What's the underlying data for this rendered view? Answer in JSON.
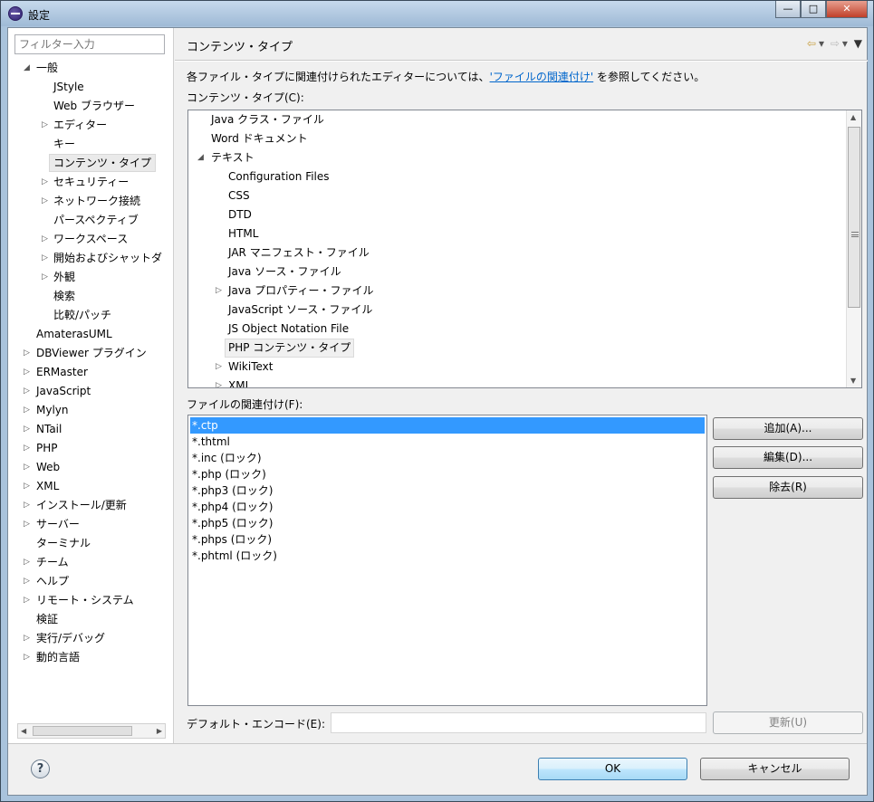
{
  "window": {
    "title": "設定",
    "min": "—",
    "max": "□",
    "close": "✕"
  },
  "nav": {
    "filter_placeholder": "フィルター入力",
    "items": [
      {
        "label": "一般",
        "arrow": "◢"
      },
      {
        "label": "JStyle",
        "arrow": ""
      },
      {
        "label": "Web ブラウザー",
        "arrow": ""
      },
      {
        "label": "エディター",
        "arrow": "▷"
      },
      {
        "label": "キー",
        "arrow": ""
      },
      {
        "label": "コンテンツ・タイプ",
        "arrow": ""
      },
      {
        "label": "セキュリティー",
        "arrow": "▷"
      },
      {
        "label": "ネットワーク接続",
        "arrow": "▷"
      },
      {
        "label": "パースペクティブ",
        "arrow": ""
      },
      {
        "label": "ワークスペース",
        "arrow": "▷"
      },
      {
        "label": "開始およびシャットダ",
        "arrow": "▷"
      },
      {
        "label": "外観",
        "arrow": "▷"
      },
      {
        "label": "検索",
        "arrow": ""
      },
      {
        "label": "比較/パッチ",
        "arrow": ""
      },
      {
        "label": "AmaterasUML",
        "arrow": ""
      },
      {
        "label": "DBViewer プラグイン",
        "arrow": "▷"
      },
      {
        "label": "ERMaster",
        "arrow": "▷"
      },
      {
        "label": "JavaScript",
        "arrow": "▷"
      },
      {
        "label": "Mylyn",
        "arrow": "▷"
      },
      {
        "label": "NTail",
        "arrow": "▷"
      },
      {
        "label": "PHP",
        "arrow": "▷"
      },
      {
        "label": "Web",
        "arrow": "▷"
      },
      {
        "label": "XML",
        "arrow": "▷"
      },
      {
        "label": "インストール/更新",
        "arrow": "▷"
      },
      {
        "label": "サーバー",
        "arrow": "▷"
      },
      {
        "label": "ターミナル",
        "arrow": ""
      },
      {
        "label": "チーム",
        "arrow": "▷"
      },
      {
        "label": "ヘルプ",
        "arrow": "▷"
      },
      {
        "label": "リモート・システム",
        "arrow": "▷"
      },
      {
        "label": "検証",
        "arrow": ""
      },
      {
        "label": "実行/デバッグ",
        "arrow": "▷"
      },
      {
        "label": "動的言語",
        "arrow": "▷"
      }
    ]
  },
  "page": {
    "title": "コンテンツ・タイプ",
    "desc_prefix": "各ファイル・タイプに関連付けられたエディターについては、",
    "desc_link": "'ファイルの関連付け'",
    "desc_suffix": " を参照してください。",
    "content_types_label": "コンテンツ・タイプ(C):",
    "file_assoc_label": "ファイルの関連付け(F):",
    "encoding_label": "デフォルト・エンコード(E):",
    "encoding_value": ""
  },
  "tree": [
    {
      "label": "Java クラス・ファイル",
      "arrow": ""
    },
    {
      "label": "Word ドキュメント",
      "arrow": ""
    },
    {
      "label": "テキスト",
      "arrow": "◢"
    },
    {
      "label": "Configuration Files",
      "arrow": ""
    },
    {
      "label": "CSS",
      "arrow": ""
    },
    {
      "label": "DTD",
      "arrow": ""
    },
    {
      "label": "HTML",
      "arrow": ""
    },
    {
      "label": "JAR マニフェスト・ファイル",
      "arrow": ""
    },
    {
      "label": "Java ソース・ファイル",
      "arrow": ""
    },
    {
      "label": "Java プロパティー・ファイル",
      "arrow": "▷"
    },
    {
      "label": "JavaScript ソース・ファイル",
      "arrow": ""
    },
    {
      "label": "JS Object Notation File",
      "arrow": ""
    },
    {
      "label": "PHP コンテンツ・タイプ",
      "arrow": ""
    },
    {
      "label": "WikiText",
      "arrow": "▷"
    },
    {
      "label": "XML",
      "arrow": "▷"
    }
  ],
  "files": [
    "*.ctp",
    "*.thtml",
    "*.inc (ロック)",
    "*.php (ロック)",
    "*.php3 (ロック)",
    "*.php4 (ロック)",
    "*.php5 (ロック)",
    "*.phps (ロック)",
    "*.phtml (ロック)"
  ],
  "buttons": {
    "add": "追加(A)...",
    "edit": "編集(D)...",
    "remove": "除去(R)",
    "update": "更新(U)",
    "ok": "OK",
    "cancel": "キャンセル",
    "help": "?"
  }
}
